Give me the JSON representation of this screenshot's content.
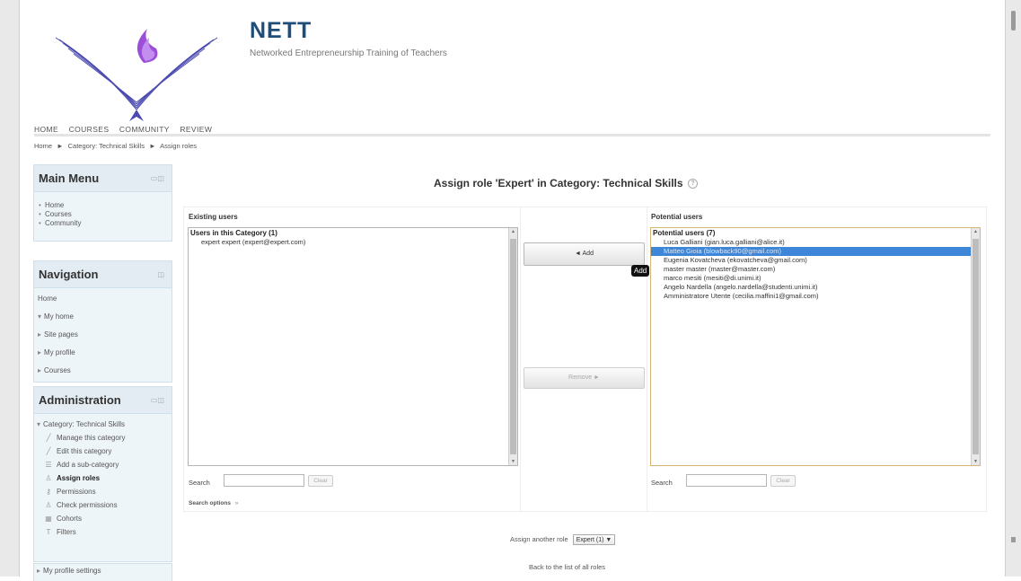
{
  "site": {
    "title": "NETT",
    "subtitle": "Networked Entrepreneurship Training of Teachers"
  },
  "topnav": [
    "HOME",
    "COURSES",
    "COMMUNITY",
    "REVIEW"
  ],
  "breadcrumb": [
    "Home",
    "►",
    "Category: Technical Skills",
    "►",
    "Assign roles"
  ],
  "blocks": {
    "main_menu": {
      "title": "Main Menu",
      "items": [
        "Home",
        "Courses",
        "Community"
      ]
    },
    "navigation": {
      "title": "Navigation",
      "items": [
        "Home",
        "My home",
        "Site pages",
        "My profile",
        "Courses"
      ]
    },
    "administration": {
      "title": "Administration",
      "category": "Category: Technical Skills",
      "items": [
        "Manage this category",
        "Edit this category",
        "Add a sub-category",
        "Assign roles",
        "Permissions",
        "Check permissions",
        "Cohorts",
        "Filters"
      ],
      "bottom": "My profile settings"
    }
  },
  "main": {
    "heading": "Assign role 'Expert' in Category: Technical Skills",
    "existing": {
      "label": "Existing users",
      "group": "Users in this Category (1)",
      "users": [
        "expert expert (expert@expert.com)"
      ]
    },
    "potential": {
      "label": "Potential users",
      "group": "Potential users (7)",
      "users": [
        "Luca Galliani (gian.luca.galliani@alice.it)",
        "Matteo Gioia (blowback90@gmail.com)",
        "Eugenia Kovatcheva (ekovatcheva@gmail.com)",
        "master master (master@master.com)",
        "marco mesiti (mesiti@di.unimi.it)",
        "Angelo Nardella (angelo.nardella@studenti.unimi.it)",
        "Amministratore Utente (cecilia.maffini1@gmail.com)"
      ],
      "selected_index": 1
    },
    "add_button": "◄ Add",
    "remove_button": "Remove ►",
    "tooltip": "Add",
    "search_label": "Search",
    "clear_button": "Clear",
    "search_options": "Search options",
    "assign_another_label": "Assign another role",
    "assign_another_value": "Expert (1) ▼",
    "back_link": "Back to the list of all roles"
  }
}
